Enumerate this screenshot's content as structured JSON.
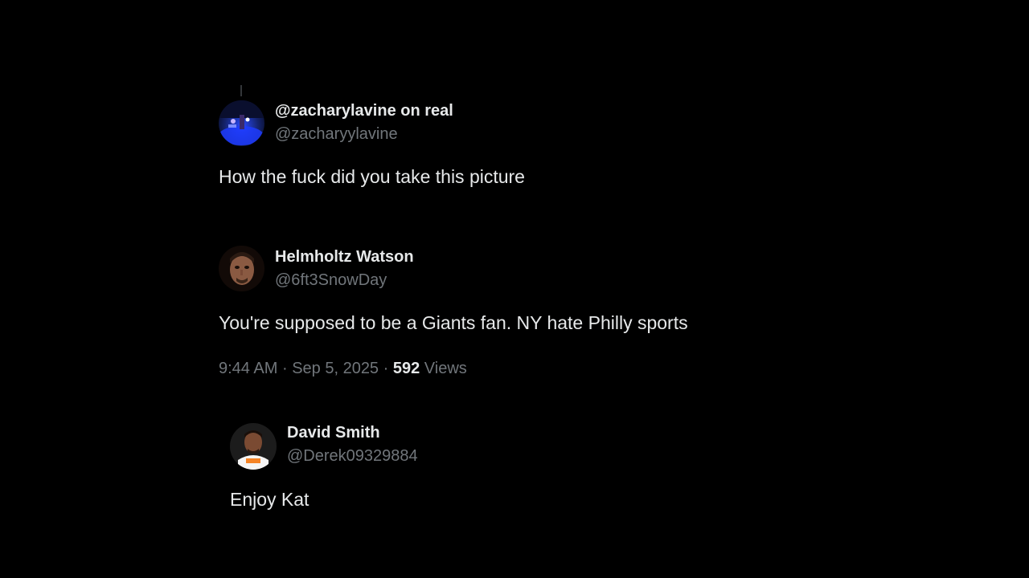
{
  "tweets": [
    {
      "name": "@zacharylavine on real",
      "handle": "@zacharyylavine",
      "text": "How the fuck did you take this picture",
      "avatar_icon": "basketball-arena-avatar",
      "avatar_colors": [
        "#0b1a4a",
        "#2a4cff",
        "#c9b6ff"
      ]
    },
    {
      "name": "Helmholtz Watson",
      "handle": "@6ft3SnowDay",
      "text": "You're supposed to be a Giants fan. NY hate Philly sports",
      "avatar_icon": "man-face-avatar",
      "avatar_colors": [
        "#1a0f0a",
        "#8a5a42",
        "#3a2418"
      ],
      "timestamp": "9:44 AM",
      "separator": "·",
      "date": "Sep 5, 2025",
      "views_count": "592",
      "views_label": "Views"
    },
    {
      "name": "David Smith",
      "handle": "@Derek09329884",
      "text": "Enjoy Kat",
      "avatar_icon": "knicks-player-avatar",
      "avatar_colors": [
        "#1a1a1a",
        "#7a4a32",
        "#f58426"
      ]
    }
  ]
}
